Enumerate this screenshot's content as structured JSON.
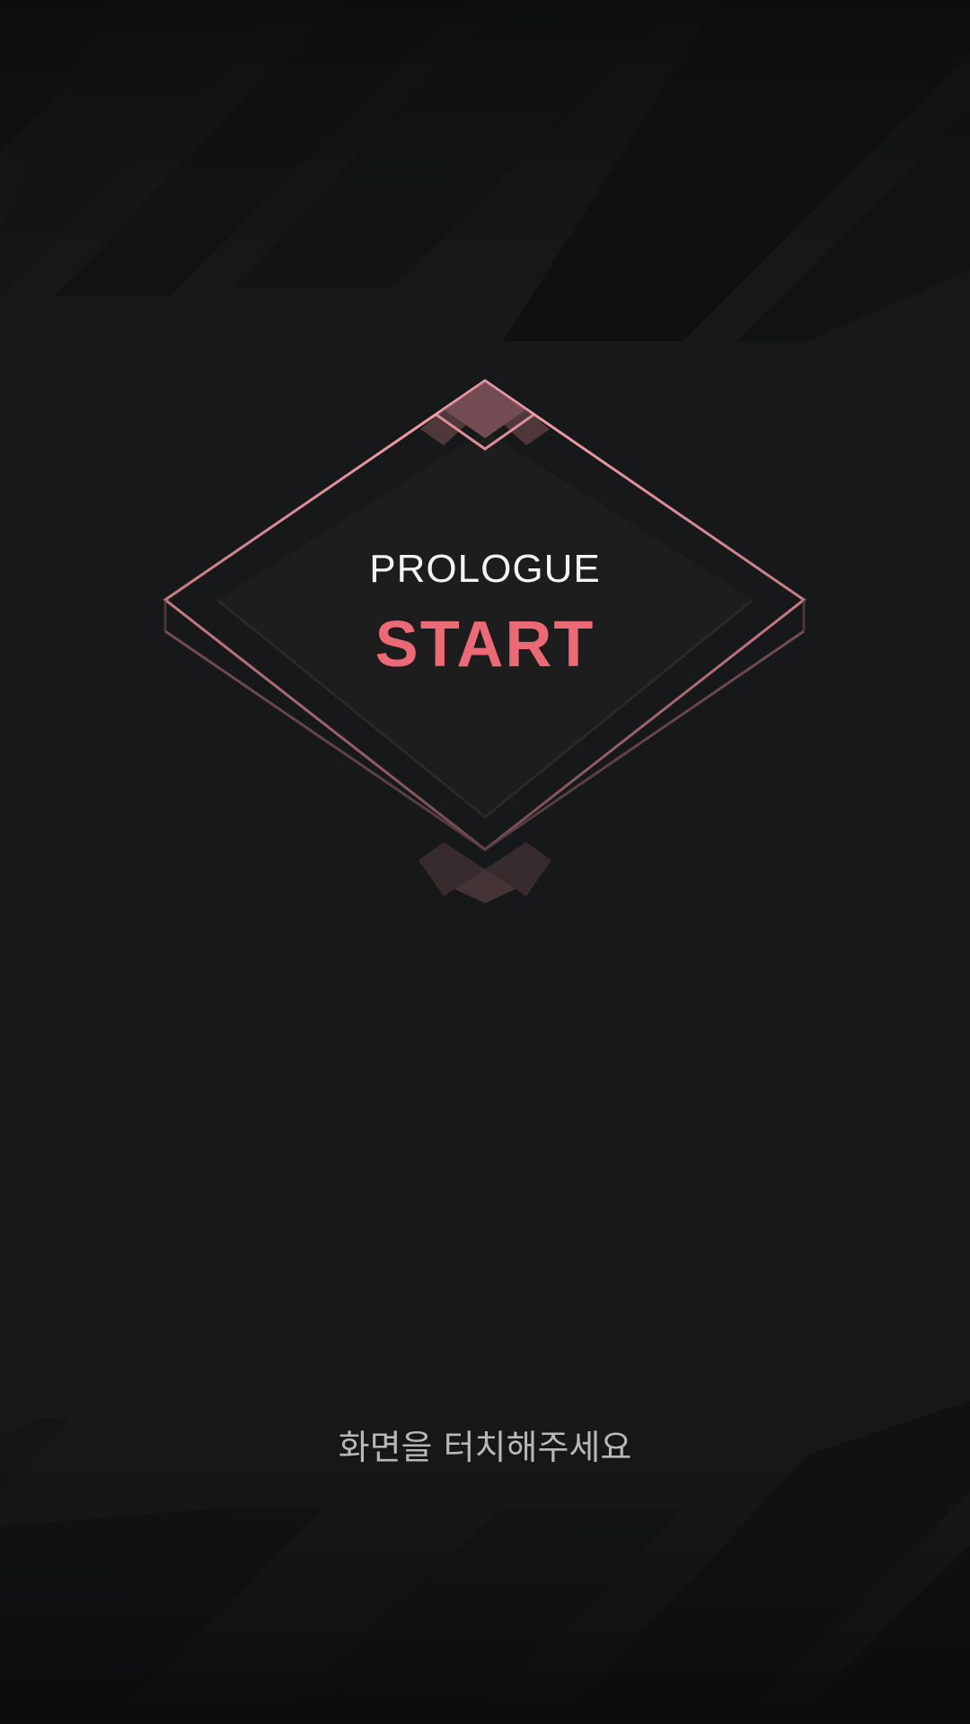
{
  "title_screen": {
    "prologue_label": "PROLOGUE",
    "start_label": "START",
    "touch_prompt": "화면을 터치해주세요"
  },
  "colors": {
    "background": "#17181a",
    "accent_pink": "#ec6a76",
    "frame_pink": "#f29aa6",
    "diamond_fill": "#1e1d1e",
    "prompt_gray": "#b8b8b8",
    "title_white": "#f4f4f4"
  }
}
